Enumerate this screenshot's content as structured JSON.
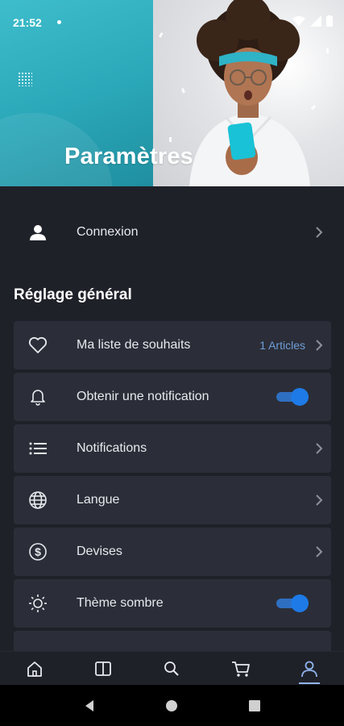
{
  "status": {
    "time": "21:52"
  },
  "header": {
    "title": "Paramètres"
  },
  "login": {
    "label": "Connexion"
  },
  "section": {
    "title": "Réglage général"
  },
  "settings": [
    {
      "label": "Ma liste de souhaits",
      "icon": "heart-icon",
      "badge": "1 Articles",
      "type": "link"
    },
    {
      "label": "Obtenir une notification",
      "icon": "bell-icon",
      "type": "toggle",
      "on": true
    },
    {
      "label": "Notifications",
      "icon": "list-icon",
      "type": "link"
    },
    {
      "label": "Langue",
      "icon": "globe-icon",
      "type": "link"
    },
    {
      "label": "Devises",
      "icon": "dollar-icon",
      "type": "link"
    },
    {
      "label": "Thème sombre",
      "icon": "sun-icon",
      "type": "toggle",
      "on": true
    }
  ],
  "bottom_nav": [
    "home-icon",
    "catalog-icon",
    "search-icon",
    "cart-icon",
    "profile-icon"
  ],
  "colors": {
    "accent": "#1e7ae6",
    "background": "#1f2129",
    "card": "#2b2e38",
    "teal": "#2aa7b8",
    "badge": "#6f9dd6"
  }
}
